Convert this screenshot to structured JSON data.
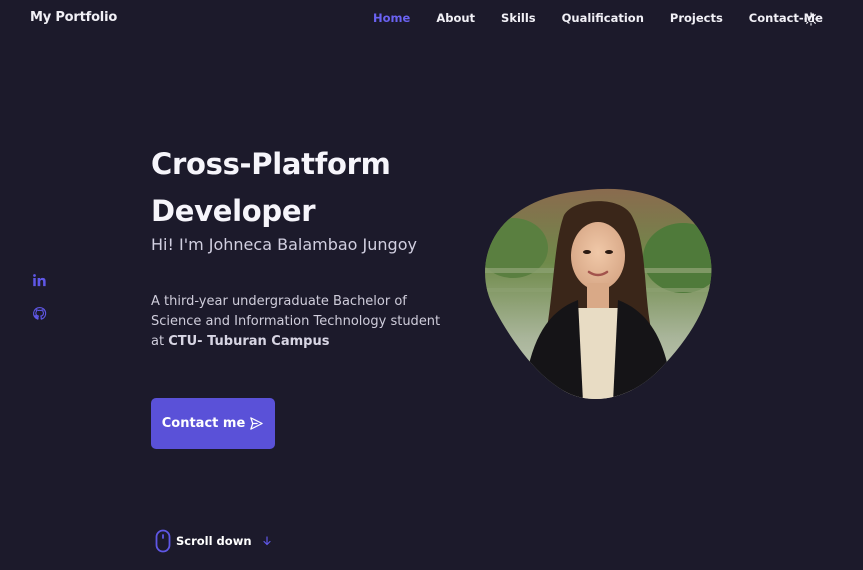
{
  "nav": {
    "logo": "My Portfolio",
    "items": [
      {
        "label": "Home",
        "active": true
      },
      {
        "label": "About"
      },
      {
        "label": "Skills"
      },
      {
        "label": "Qualification"
      },
      {
        "label": "Projects"
      },
      {
        "label": "Contact-Me"
      }
    ],
    "theme_icon": "sun-icon"
  },
  "socials": [
    {
      "icon": "linkedin-icon"
    },
    {
      "icon": "github-icon"
    }
  ],
  "hero": {
    "title": "Cross-Platform Developer",
    "subtitle": "Hi! I'm Johneca Balambao Jungoy",
    "description_prefix": "A third-year undergraduate Bachelor of Science and Information Technology student at ",
    "description_bold": "CTU- Tuburan Campus",
    "contact_label": "Contact me",
    "contact_icon": "send-icon"
  },
  "scroll": {
    "label": "Scroll down",
    "icons": [
      "mouse-icon",
      "arrow-down-icon"
    ]
  },
  "colors": {
    "background": "#1c1a2b",
    "accent": "#5a51d8",
    "nav_active": "#6a62f2"
  }
}
